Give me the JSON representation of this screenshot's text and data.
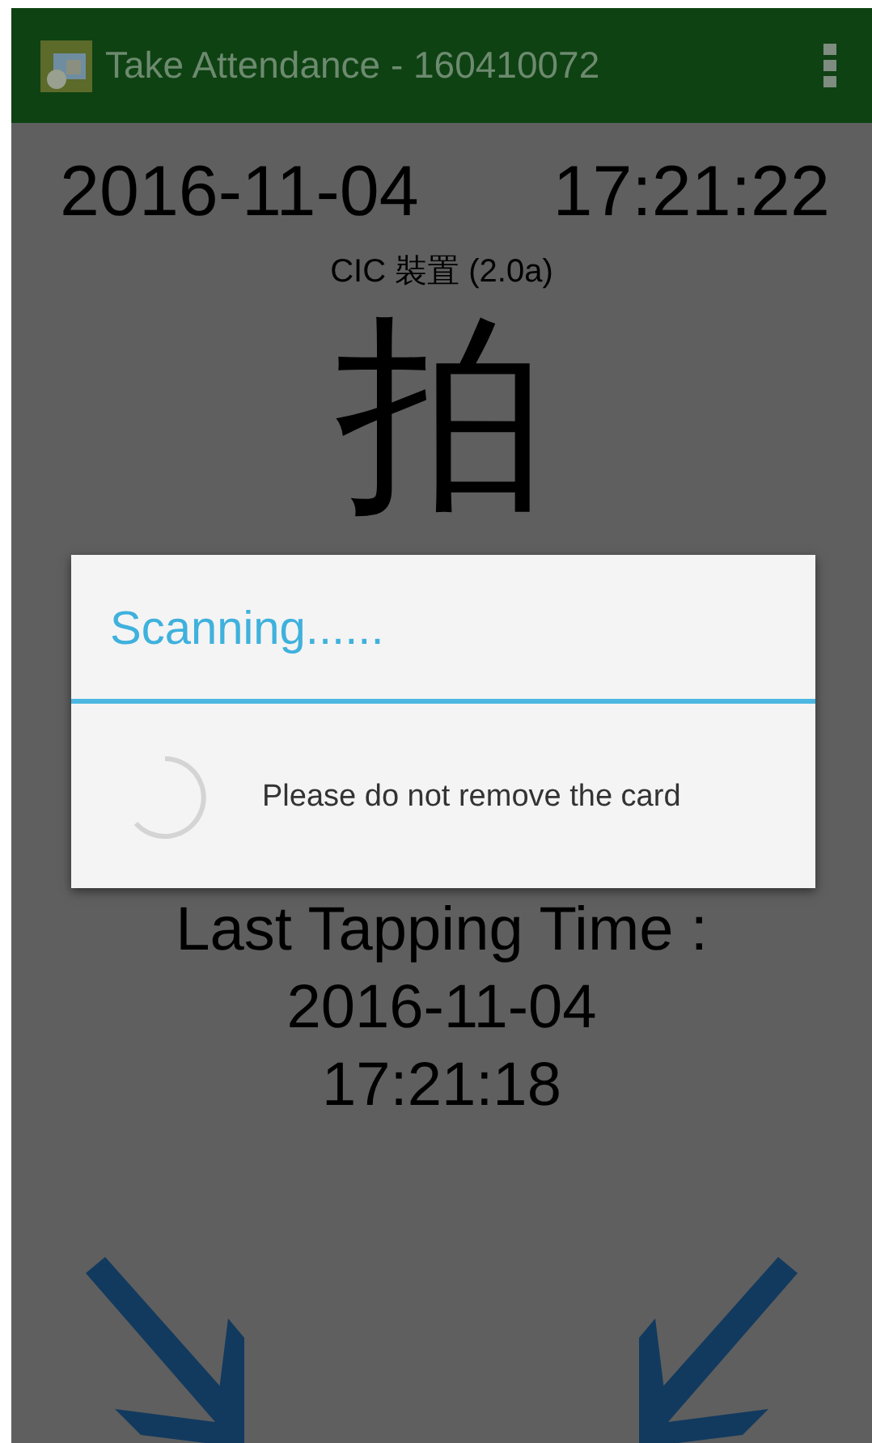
{
  "app_bar": {
    "title": "Take Attendance - 160410072"
  },
  "clock": {
    "date": "2016-11-04",
    "time": "17:21:22"
  },
  "device": "CIC 裝置 (2.0a)",
  "prompt_character": "拍",
  "last_tap": {
    "label": "Last Tapping Time :",
    "date": "2016-11-04",
    "time": "17:21:18"
  },
  "dialog": {
    "title": "Scanning......",
    "message": "Please do not remove the card"
  }
}
